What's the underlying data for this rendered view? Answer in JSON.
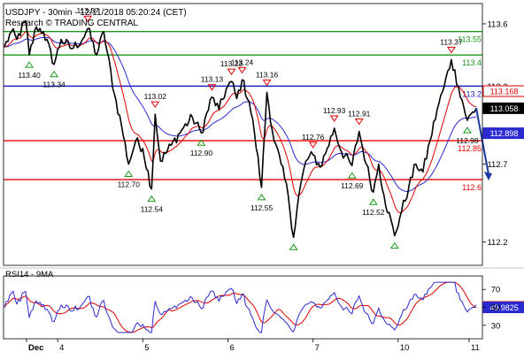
{
  "header": {
    "line1": "USDJPY - 30min - 12/11/2018 05:20:24 (CET)",
    "line2": "Research © TRADING CENTRAL"
  },
  "colors": {
    "price": "#000000",
    "ma_fast": "#e00000",
    "ma_slow": "#2a2ad0",
    "support_line": "#ee0000",
    "resistance_line": "#1a9a1a",
    "pivot_line": "#2020c0",
    "arrow": "#1a3aa0"
  },
  "chart_data": [
    {
      "type": "line",
      "name": "price-panel",
      "ylim": [
        112.05,
        113.73
      ],
      "x_tick_labels": [
        "Dec",
        "4",
        "5",
        "6",
        "7",
        "10",
        "11"
      ],
      "y_tick_labels": [
        "113.6",
        "113.2",
        "112.7",
        "112.2"
      ],
      "y_tick_values": [
        113.6,
        113.2,
        112.7,
        112.2
      ],
      "horizontal_levels": [
        {
          "value": 113.55,
          "label": "113.55",
          "kind": "resistance"
        },
        {
          "value": 113.4,
          "label": "113.4",
          "kind": "resistance"
        },
        {
          "value": 113.2,
          "label": "113.2",
          "kind": "pivot"
        },
        {
          "value": 112.85,
          "label": "112.85",
          "kind": "support"
        },
        {
          "value": 112.6,
          "label": "112.6",
          "kind": "support"
        }
      ],
      "price_boxes": [
        {
          "value": 113.168,
          "label": "113.168",
          "kind": "ma_fast"
        },
        {
          "value": 113.058,
          "label": "113.058",
          "kind": "price"
        },
        {
          "value": 112.898,
          "label": "112.898",
          "kind": "ma_slow"
        }
      ],
      "annotations": [
        {
          "i": 14,
          "y": 113.4,
          "label": "113.40",
          "dir": "low"
        },
        {
          "i": 28,
          "y": 113.34,
          "label": "113.34",
          "dir": "low"
        },
        {
          "i": 47,
          "y": 113.57,
          "label": "113.57",
          "dir": "high"
        },
        {
          "i": 70,
          "y": 112.7,
          "label": "112.70",
          "dir": "low"
        },
        {
          "i": 83,
          "y": 112.54,
          "label": "112.54",
          "dir": "low"
        },
        {
          "i": 85,
          "y": 113.02,
          "label": "113.02",
          "dir": "high"
        },
        {
          "i": 111,
          "y": 112.9,
          "label": "112.90",
          "dir": "low"
        },
        {
          "i": 117,
          "y": 113.13,
          "label": "113.13",
          "dir": "high"
        },
        {
          "i": 128,
          "y": 113.23,
          "label": "113.23",
          "dir": "high"
        },
        {
          "i": 134,
          "y": 113.24,
          "label": "113.24",
          "dir": "high"
        },
        {
          "i": 148,
          "y": 113.16,
          "label": "113.16",
          "dir": "high"
        },
        {
          "i": 145,
          "y": 112.55,
          "label": "112.55",
          "dir": "low"
        },
        {
          "i": 163,
          "y": 112.23,
          "label": "",
          "dir": "low"
        },
        {
          "i": 174,
          "y": 112.76,
          "label": "112.76",
          "dir": "high"
        },
        {
          "i": 186,
          "y": 112.93,
          "label": "112.93",
          "dir": "high"
        },
        {
          "i": 196,
          "y": 112.69,
          "label": "112.69",
          "dir": "low"
        },
        {
          "i": 200,
          "y": 112.91,
          "label": "112.91",
          "dir": "high"
        },
        {
          "i": 208,
          "y": 112.52,
          "label": "112.52",
          "dir": "low"
        },
        {
          "i": 220,
          "y": 112.24,
          "label": "",
          "dir": "low"
        },
        {
          "i": 252,
          "y": 113.37,
          "label": "113.37",
          "dir": "high"
        },
        {
          "i": 261,
          "y": 112.98,
          "label": "112.98",
          "dir": "low"
        }
      ],
      "price_keypoints": [
        [
          0,
          113.45
        ],
        [
          4,
          113.55
        ],
        [
          7,
          113.5
        ],
        [
          12,
          113.62
        ],
        [
          14,
          113.4
        ],
        [
          18,
          113.58
        ],
        [
          22,
          113.55
        ],
        [
          28,
          113.34
        ],
        [
          32,
          113.5
        ],
        [
          38,
          113.44
        ],
        [
          44,
          113.5
        ],
        [
          47,
          113.57
        ],
        [
          52,
          113.4
        ],
        [
          56,
          113.55
        ],
        [
          62,
          113.15
        ],
        [
          66,
          112.95
        ],
        [
          70,
          112.7
        ],
        [
          74,
          112.85
        ],
        [
          78,
          112.8
        ],
        [
          83,
          112.54
        ],
        [
          85,
          113.02
        ],
        [
          88,
          112.72
        ],
        [
          94,
          112.82
        ],
        [
          100,
          112.92
        ],
        [
          106,
          113.0
        ],
        [
          111,
          112.9
        ],
        [
          117,
          113.13
        ],
        [
          121,
          113.05
        ],
        [
          125,
          113.18
        ],
        [
          128,
          113.23
        ],
        [
          131,
          113.12
        ],
        [
          134,
          113.24
        ],
        [
          138,
          113.1
        ],
        [
          141,
          112.9
        ],
        [
          145,
          112.55
        ],
        [
          148,
          113.16
        ],
        [
          152,
          112.85
        ],
        [
          156,
          112.7
        ],
        [
          160,
          112.5
        ],
        [
          163,
          112.23
        ],
        [
          166,
          112.5
        ],
        [
          170,
          112.72
        ],
        [
          174,
          112.76
        ],
        [
          178,
          112.68
        ],
        [
          182,
          112.8
        ],
        [
          186,
          112.93
        ],
        [
          190,
          112.78
        ],
        [
          196,
          112.69
        ],
        [
          200,
          112.91
        ],
        [
          204,
          112.7
        ],
        [
          208,
          112.52
        ],
        [
          211,
          112.7
        ],
        [
          214,
          112.5
        ],
        [
          220,
          112.24
        ],
        [
          224,
          112.4
        ],
        [
          228,
          112.55
        ],
        [
          232,
          112.7
        ],
        [
          236,
          112.65
        ],
        [
          240,
          112.85
        ],
        [
          244,
          113.05
        ],
        [
          248,
          113.2
        ],
        [
          252,
          113.37
        ],
        [
          256,
          113.2
        ],
        [
          261,
          112.98
        ],
        [
          266,
          113.06
        ]
      ],
      "forecast_arrow": {
        "from": 113.06,
        "to": 112.6
      }
    },
    {
      "type": "line",
      "name": "RSI14 - 9MA",
      "title": "RSI14 - 9MA",
      "ylim": [
        15,
        85
      ],
      "y_tick_labels": [
        "70",
        "50",
        "30"
      ],
      "y_tick_values": [
        70,
        50,
        30
      ],
      "price_boxes": [
        {
          "value": 50.5,
          "label": "50.5006",
          "kind": "ma_fast"
        },
        {
          "value": 49.98,
          "label": "49.9825",
          "kind": "ma_slow"
        }
      ]
    }
  ]
}
